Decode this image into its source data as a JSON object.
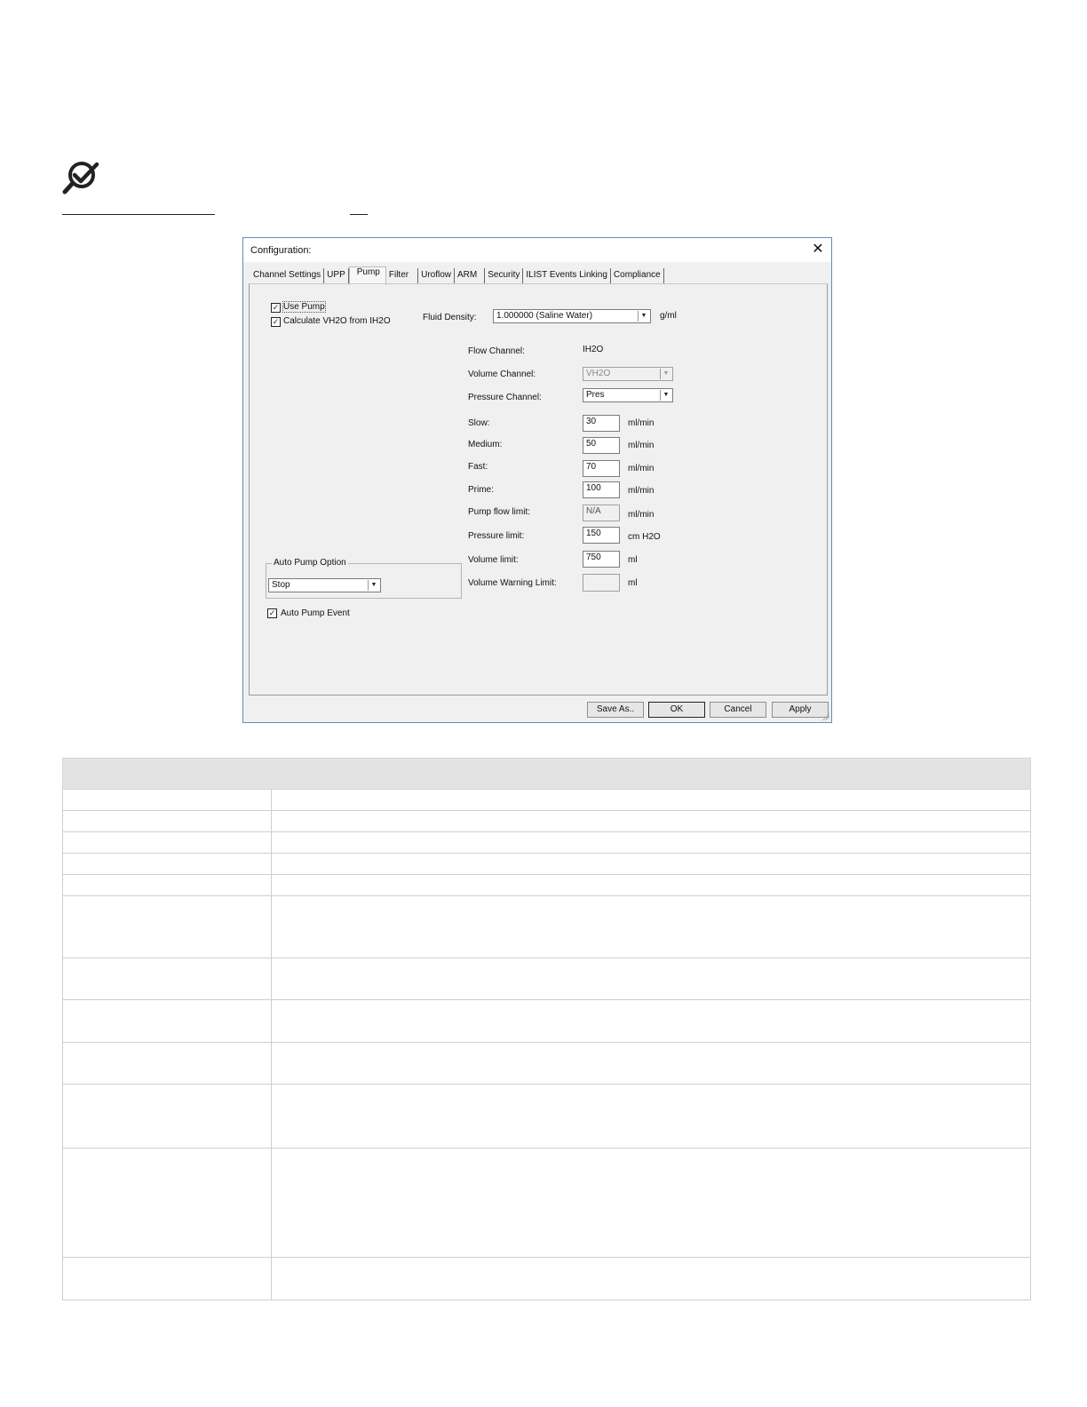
{
  "dialog": {
    "title": "Configuration:",
    "tabs": [
      {
        "label": "Channel Settings"
      },
      {
        "label": "UPP"
      },
      {
        "label": "Pump",
        "active": true
      },
      {
        "label": "Filter"
      },
      {
        "label": "Uroflow"
      },
      {
        "label": "ARM"
      },
      {
        "label": "Security"
      },
      {
        "label": "ILIST Events Linking"
      },
      {
        "label": "Compliance"
      }
    ],
    "pump": {
      "use_pump": {
        "label": "Use Pump",
        "checked": true
      },
      "calc_vh2o": {
        "label": "Calculate VH2O from IH2O",
        "checked": true
      },
      "fluid_density": {
        "label": "Fluid Density:",
        "value": "1.000000 (Saline Water)",
        "unit": "g/ml"
      },
      "flow_channel": {
        "label": "Flow Channel:",
        "value": "IH2O"
      },
      "volume_channel": {
        "label": "Volume Channel:",
        "value": "VH2O"
      },
      "pressure_channel": {
        "label": "Pressure Channel:",
        "value": "Pres"
      },
      "slow": {
        "label": "Slow:",
        "value": "30",
        "unit": "ml/min"
      },
      "medium": {
        "label": "Medium:",
        "value": "50",
        "unit": "ml/min"
      },
      "fast": {
        "label": "Fast:",
        "value": "70",
        "unit": "ml/min"
      },
      "prime": {
        "label": "Prime:",
        "value": "100",
        "unit": "ml/min"
      },
      "pump_flow_limit": {
        "label": "Pump flow limit:",
        "value": "N/A",
        "unit": "ml/min"
      },
      "pressure_limit": {
        "label": "Pressure limit:",
        "value": "150",
        "unit": "cm H2O"
      },
      "volume_limit": {
        "label": "Volume limit:",
        "value": "750",
        "unit": "ml"
      },
      "volume_warning_limit": {
        "label": "Volume Warning Limit:",
        "value": "",
        "unit": "ml"
      },
      "auto_pump_option": {
        "label": "Auto Pump Option",
        "value": "Stop"
      },
      "auto_pump_event": {
        "label": "Auto Pump Event",
        "checked": true
      }
    },
    "buttons": {
      "save_as": "Save As..",
      "ok": "OK",
      "cancel": "Cancel",
      "apply": "Apply"
    }
  },
  "colors": {
    "dialog_border": "#6a8ab8",
    "dialog_bg": "#f0f0f0",
    "table_header_bg": "#e3e3e3"
  },
  "icons": [
    "check-search-icon",
    "close-icon",
    "dropdown-arrow-icon",
    "checkbox-check-icon"
  ]
}
